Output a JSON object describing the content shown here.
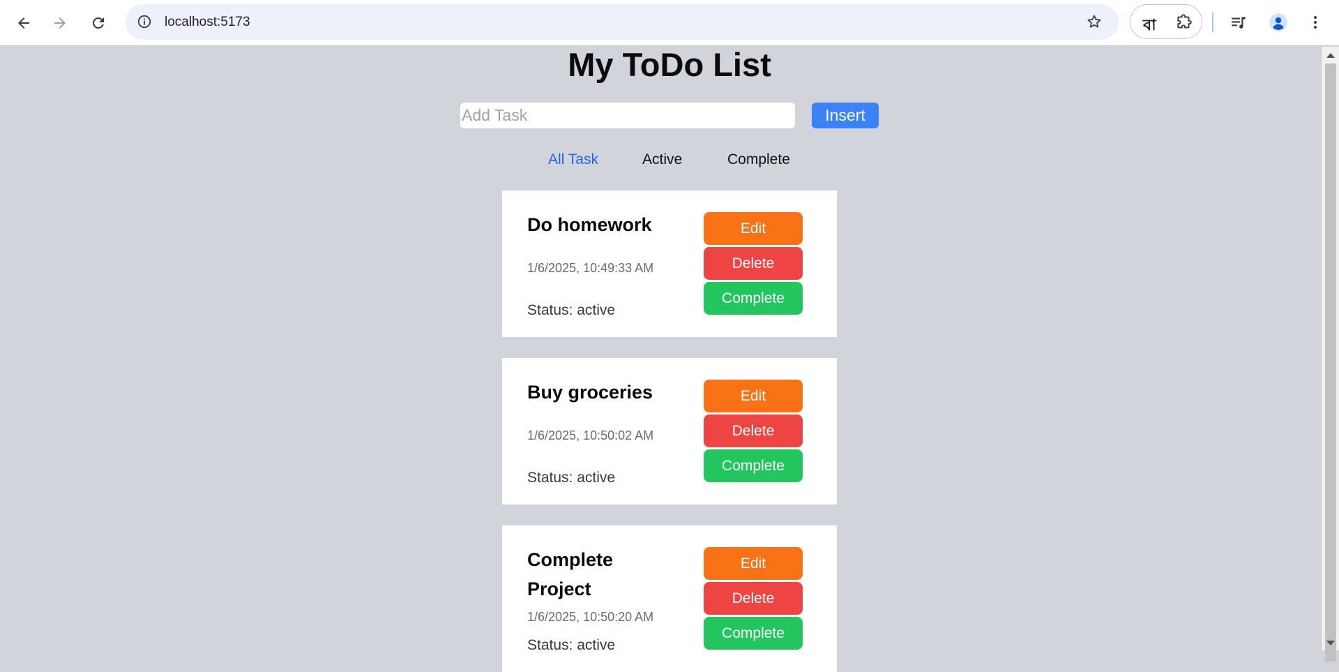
{
  "browser": {
    "url": "localhost:5173",
    "extension_label": "বা"
  },
  "app": {
    "title": "My ToDo List",
    "input_placeholder": "Add Task",
    "input_value": "",
    "insert_label": "Insert",
    "filters": [
      {
        "label": "All Task",
        "selected": true
      },
      {
        "label": "Active",
        "selected": false
      },
      {
        "label": "Complete",
        "selected": false
      }
    ],
    "tasks": [
      {
        "title": "Do homework",
        "date": "1/6/2025, 10:49:33 AM",
        "status": "Status: active"
      },
      {
        "title": "Buy groceries",
        "date": "1/6/2025, 10:50:02 AM",
        "status": "Status: active"
      },
      {
        "title": "Complete Project",
        "date": "1/6/2025, 10:50:20 AM",
        "status": "Status: active"
      }
    ],
    "buttons": {
      "edit": "Edit",
      "delete": "Delete",
      "complete": "Complete"
    }
  },
  "colors": {
    "background": "#d1d5db",
    "insert": "#3b82f6",
    "active_filter": "#2563eb",
    "edit": "#f97316",
    "delete": "#ef4444",
    "complete": "#22c55e"
  }
}
